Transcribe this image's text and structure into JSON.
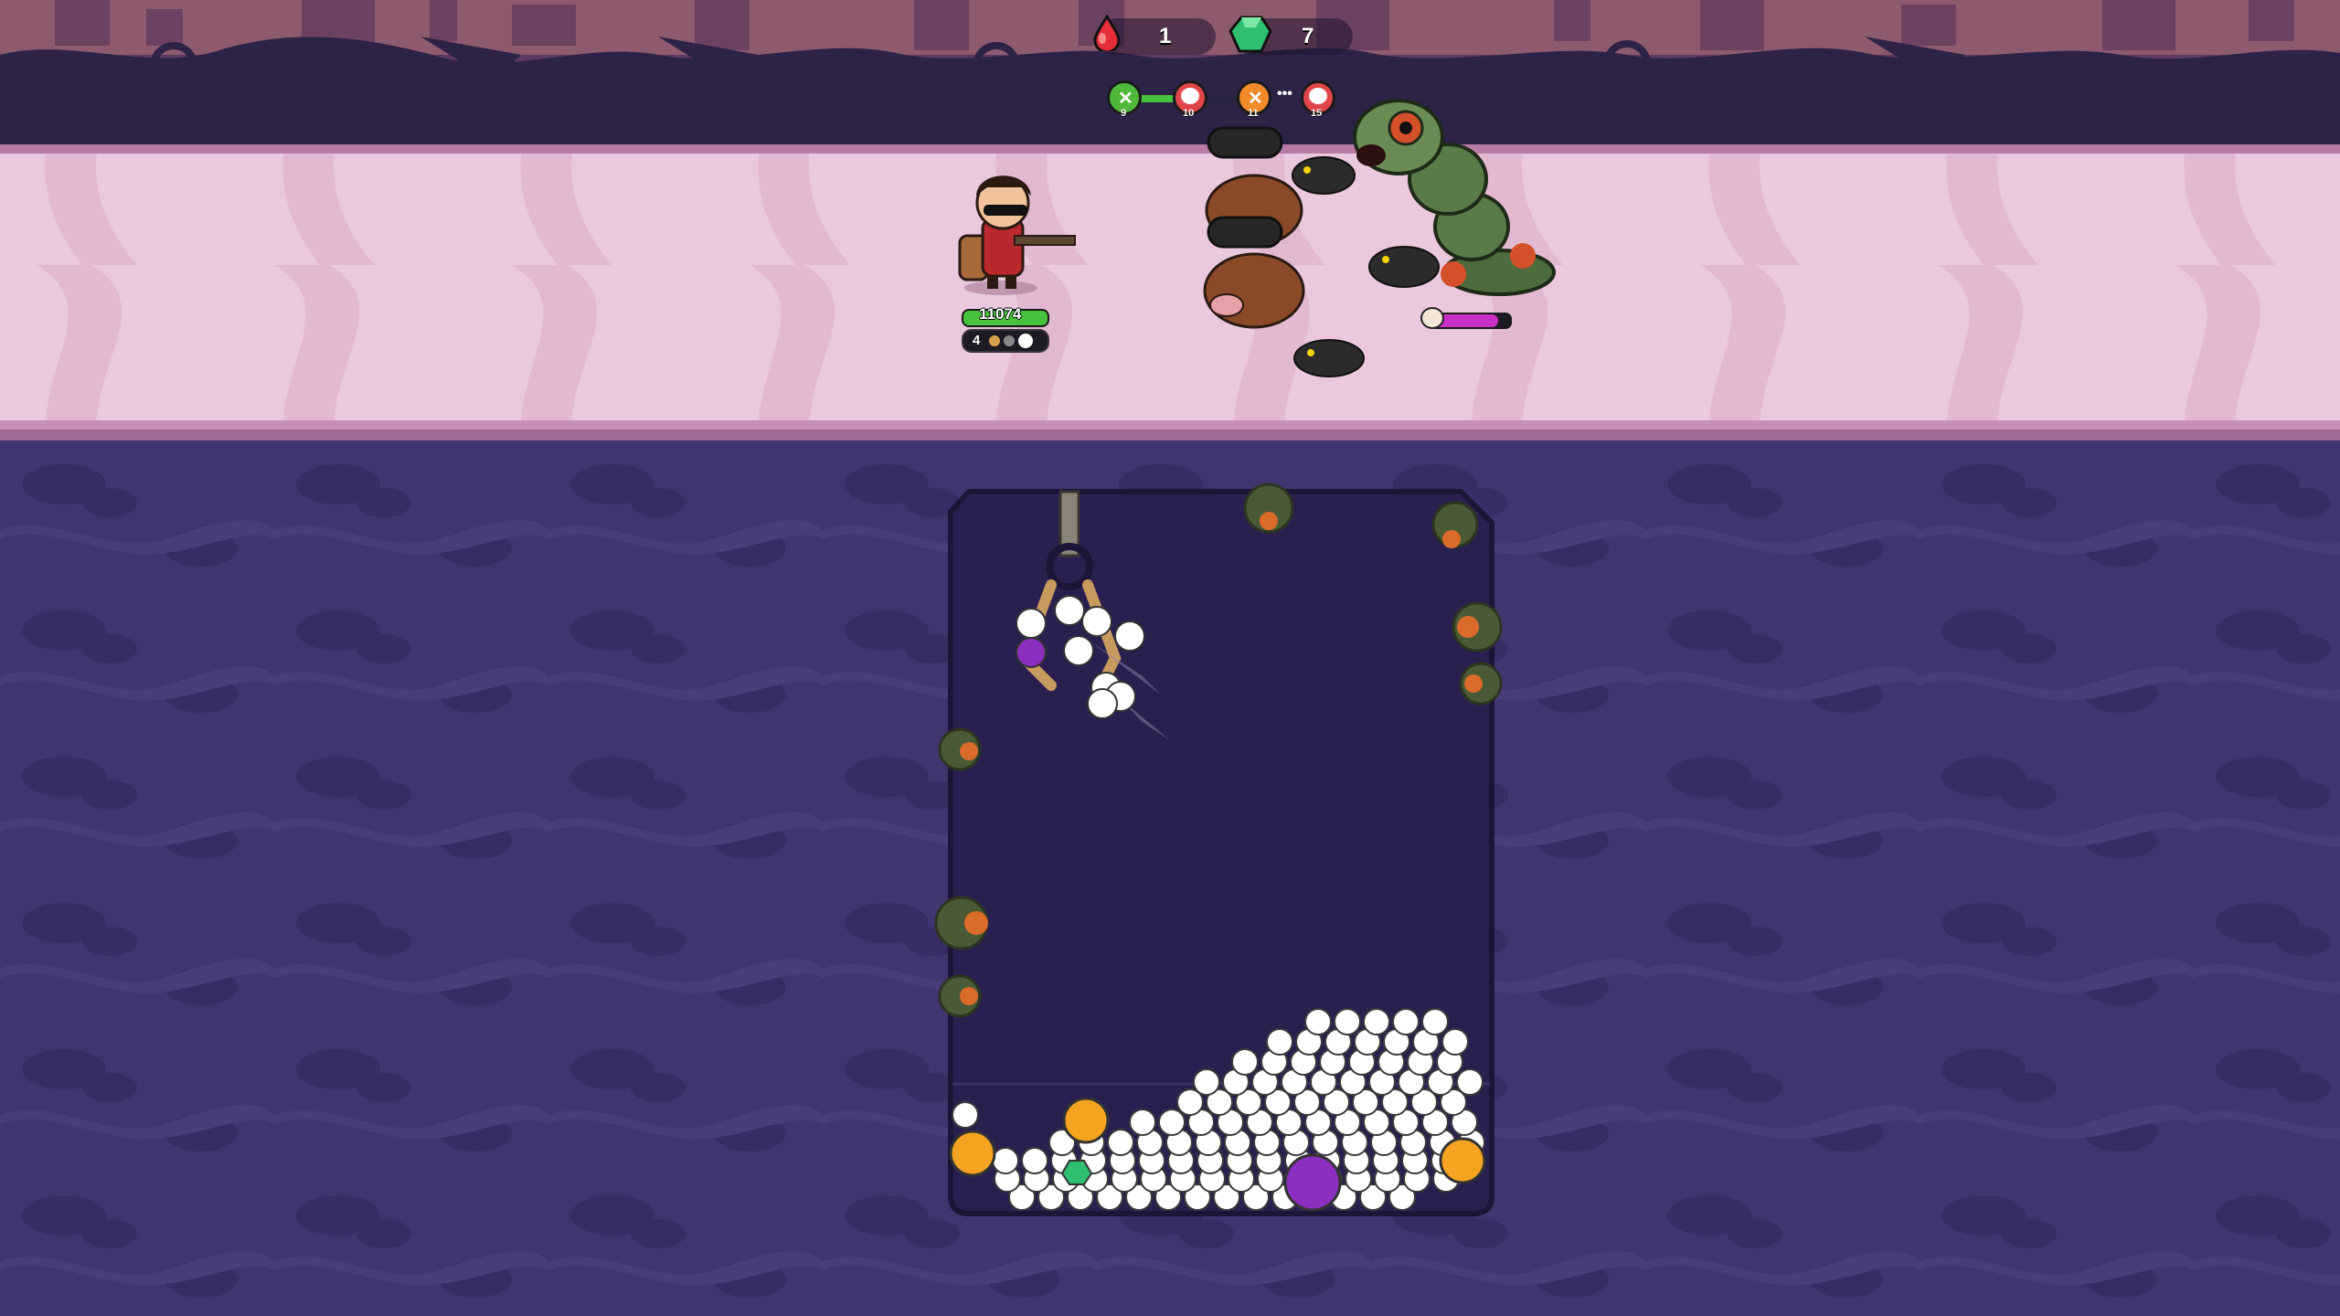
{
  "hud": {
    "blood_count": "1",
    "gem_count": "7",
    "icons": {
      "blood": "blood-drop-icon",
      "gem": "green-gem-icon"
    }
  },
  "wave_progress": {
    "markers": [
      {
        "label": "9",
        "icon": "wave-cleared-icon",
        "color": "#4fb83a"
      },
      {
        "label": "10",
        "icon": "boss-pig-icon",
        "color": "#e0454a"
      },
      {
        "label": "11",
        "icon": "wave-orange-icon",
        "color": "#f08a2a"
      },
      {
        "label": "15",
        "icon": "boss-pig-icon",
        "color": "#e0454a"
      }
    ],
    "ellipsis": "•••"
  },
  "player": {
    "hp": "11074",
    "ammo_count": "4"
  },
  "boss": {
    "health_fraction": 0.85,
    "icon": "skull-icon"
  },
  "colors": {
    "road": "#eac8dd",
    "road_edge": "#b77ba6",
    "sky": "#5a3a6e",
    "ground": "#3f3470",
    "pit": "#281f4c",
    "hp_green": "#47c23c",
    "boss_bar": "#c72fc7"
  }
}
